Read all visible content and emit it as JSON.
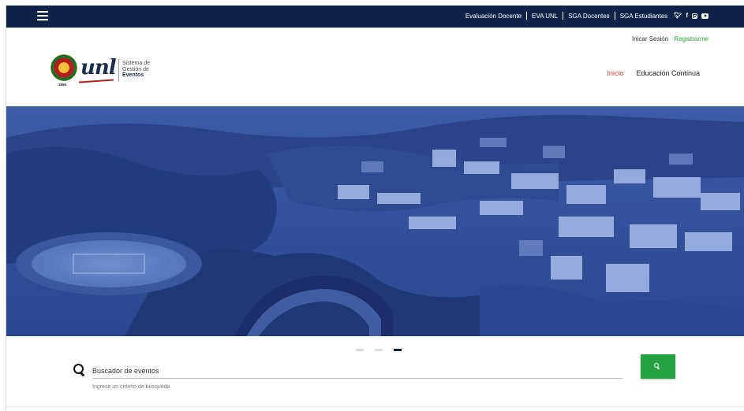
{
  "topbar": {
    "links": [
      "Evaluación Docente",
      "EVA UNL",
      "SGA Docentes",
      "SGA Estudiantes"
    ],
    "social": [
      "twitter-icon",
      "facebook-icon",
      "instagram-icon",
      "youtube-icon"
    ],
    "background": "#0d2347"
  },
  "header": {
    "login": "Inicar Sesión",
    "register": "Registrarme",
    "logo": {
      "wordmark": "unl",
      "line1": "Sistema de",
      "line2": "Gestión de",
      "line3": "Eventos",
      "year": "1859"
    },
    "nav": [
      {
        "label": "Inicio",
        "active": true
      },
      {
        "label": "Educación Continua",
        "active": false
      }
    ]
  },
  "hero": {
    "slides": 3,
    "active_slide": 3,
    "tint": "#2f4f9a"
  },
  "search": {
    "placeholder": "Buscador de eventos",
    "hint": "Ingrese un criterio de búsqueda",
    "button_color": "#27a243"
  },
  "colors": {
    "accent_red": "#e33a3a",
    "register_green": "#2e9d3a"
  }
}
